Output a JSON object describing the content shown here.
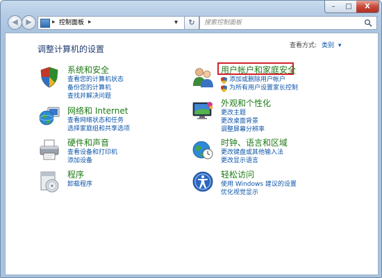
{
  "titlebar": {
    "minimize": "–",
    "maximize": "□",
    "close": "X"
  },
  "nav": {
    "back": "◀",
    "forward": "▶",
    "crumb_arrow": "▸",
    "address_text": "控制面板",
    "dropdown": "▾",
    "refresh": "↻",
    "search_placeholder": "搜索控制面板"
  },
  "header": {
    "title": "调整计算机的设置",
    "view_label": "查看方式:",
    "view_value": "类别"
  },
  "left": [
    {
      "title": "系统和安全",
      "icon": "shield-icon",
      "links": [
        "查看您的计算机状态",
        "备份您的计算机",
        "查找并解决问题"
      ]
    },
    {
      "title": "网络和 Internet",
      "icon": "network-globe-icon",
      "links": [
        "查看网络状态和任务",
        "选择家庭组和共享选项"
      ]
    },
    {
      "title": "硬件和声音",
      "icon": "printer-icon",
      "links": [
        "查看设备和打印机",
        "添加设备"
      ]
    },
    {
      "title": "程序",
      "icon": "programs-disc-icon",
      "links": [
        "卸载程序"
      ]
    }
  ],
  "right": [
    {
      "title": "用户帐户和家庭安全",
      "icon": "users-icon",
      "highlighted": true,
      "links": [
        "添加或删除用户帐户",
        "为所有用户设置家长控制"
      ]
    },
    {
      "title": "外观和个性化",
      "icon": "appearance-icon",
      "links": [
        "更改主题",
        "更改桌面背景",
        "调整屏幕分辨率"
      ]
    },
    {
      "title": "时钟、语言和区域",
      "icon": "clock-globe-icon",
      "links": [
        "更改键盘或其他输入法",
        "更改显示语言"
      ]
    },
    {
      "title": "轻松访问",
      "icon": "ease-of-access-icon",
      "links": [
        "使用 Windows 建议的设置",
        "优化视觉显示"
      ]
    }
  ],
  "colors": {
    "category_title": "#1e7a16",
    "link": "#0d55a8",
    "highlight_border": "#d0202a",
    "header_title": "#1e3c6e"
  }
}
